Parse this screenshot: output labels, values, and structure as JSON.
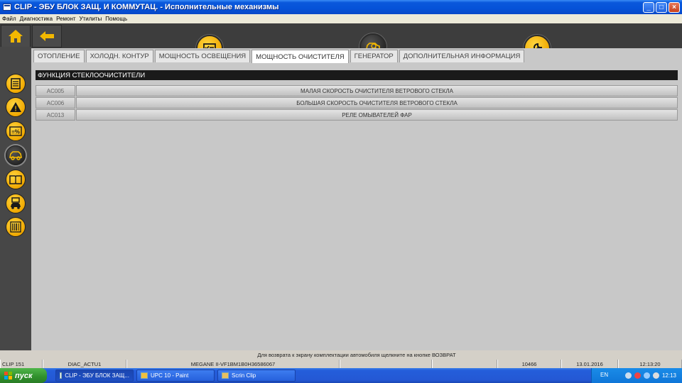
{
  "window": {
    "title": "CLIP - ЭБУ БЛОК ЗАЩ. И КОММУТАЦ. - Исполнительные механизмы",
    "buttons": [
      "_",
      "□",
      "×"
    ]
  },
  "menu": [
    "Файл",
    "Диагностика",
    "Ремонт",
    "Утилиты",
    "Помощь"
  ],
  "nav_buttons": [
    "home-icon",
    "back-arrow-icon",
    "print-icon",
    "help-icon"
  ],
  "nav_help_glyph": "?",
  "toolbar": {
    "buttons": [
      "checklist-icon",
      "car-diagnostic-icon",
      "wrench-icon"
    ],
    "active": "car-diagnostic-icon"
  },
  "sidebar": {
    "icons": [
      "document-list-icon",
      "warning-icon",
      "parameters-percent-icon",
      "car-actuator-icon",
      "manual-book-icon",
      "vehicle-service-icon",
      "barcode-icon"
    ],
    "warning_glyph": "!",
    "percent_glyph": "≡%",
    "active_index": 3
  },
  "tabs": [
    {
      "label": "ОТОПЛЕНИЕ",
      "active": false
    },
    {
      "label": "ХОЛОДН. КОНТУР",
      "active": false
    },
    {
      "label": "МОЩНОСТЬ ОСВЕЩЕНИЯ",
      "active": false
    },
    {
      "label": "МОЩНОСТЬ ОЧИСТИТЕЛЯ",
      "active": true
    },
    {
      "label": "ГЕНЕРАТОР",
      "active": false
    },
    {
      "label": "ДОПОЛНИТЕЛЬНАЯ ИНФОРМАЦИЯ",
      "active": false
    }
  ],
  "section": {
    "title": "ФУНКЦИЯ СТЕКЛООЧИСТИТЕЛИ"
  },
  "actuators": [
    {
      "code": "AC005",
      "label": "МАЛАЯ СКОРОСТЬ ОЧИСТИТЕЛЯ ВЕТРОВОГО СТЕКЛА"
    },
    {
      "code": "AC006",
      "label": "БОЛЬШАЯ СКОРОСТЬ ОЧИСТИТЕЛЯ ВЕТРОВОГО СТЕКЛА"
    },
    {
      "code": "AC013",
      "label": "РЕЛЕ ОМЫВАТЕЛЕЙ ФАР"
    }
  ],
  "hint": "Для возврата к экрану комплектации автомобиля щелкните на кнопке ВОЗВРАТ",
  "status": {
    "clip": "CLIP 151",
    "diag": "DIAC_ACTU1",
    "vehicle": "MEGANE II-VF1BM1B0H36586067",
    "empty1": "",
    "empty2": "",
    "code": "10466",
    "date": "13.01.2016",
    "time": "12:13:20"
  },
  "taskbar": {
    "start": "пуск",
    "items": [
      {
        "label": "CLIP - ЭБУ БЛОК ЗАЩ...",
        "active": true
      },
      {
        "label": "UPC 10 - Paint",
        "active": false
      },
      {
        "label": "Scrin Clip",
        "active": false
      }
    ],
    "lang": "EN",
    "clock": "12:13"
  },
  "colors": {
    "accent": "#f3b800",
    "background": "#3d3d3d",
    "content": "#c8c8c8",
    "header": "#1a1a1a",
    "titlebar": "#0552d8"
  }
}
